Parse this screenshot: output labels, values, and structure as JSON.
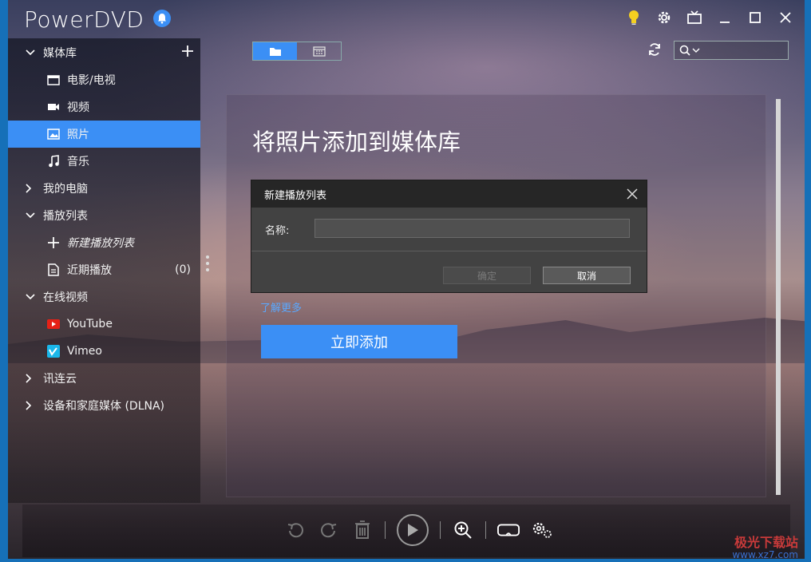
{
  "app": {
    "title": "PowerDVD"
  },
  "sidebar": {
    "media_library": "媒体库",
    "movies_tv": "电影/电视",
    "videos": "视频",
    "photos": "照片",
    "music": "音乐",
    "my_computer": "我的电脑",
    "playlists": "播放列表",
    "new_playlist": "新建播放列表",
    "recently_played": "近期播放",
    "recently_played_count": "(0)",
    "online_video": "在线视频",
    "youtube": "YouTube",
    "vimeo": "Vimeo",
    "xunlian_cloud": "讯连云",
    "dlna": "设备和家庭媒体 (DLNA)"
  },
  "main": {
    "heading": "将照片添加到媒体库",
    "learn_more": "了解更多",
    "add_now": "立即添加"
  },
  "dialog": {
    "title": "新建播放列表",
    "name_label": "名称:",
    "name_value": "",
    "ok": "确定",
    "cancel": "取消"
  },
  "watermark": {
    "line1": "极光下载站",
    "line2": "www.xz7.com"
  },
  "colors": {
    "accent": "#3b8ff5",
    "link": "#5aa8ff"
  }
}
